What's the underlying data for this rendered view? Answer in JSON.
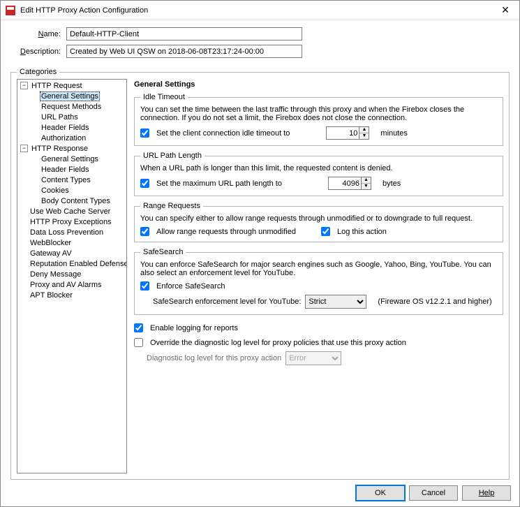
{
  "window": {
    "title": "Edit HTTP Proxy Action Configuration"
  },
  "header": {
    "name_label": "Name:",
    "name_value": "Default-HTTP-Client",
    "desc_label": "Description:",
    "desc_value": "Created by Web UI QSW on 2018-06-08T23:17:24-00:00"
  },
  "categories": {
    "legend": "Categories",
    "tree": {
      "http_request": "HTTP Request",
      "req_general": "General Settings",
      "req_methods": "Request Methods",
      "url_paths": "URL Paths",
      "header_fields": "Header Fields",
      "authorization": "Authorization",
      "http_response": "HTTP Response",
      "resp_general": "General Settings",
      "resp_header": "Header Fields",
      "content_types": "Content Types",
      "cookies": "Cookies",
      "body_content": "Body Content Types",
      "web_cache": "Use Web Cache Server",
      "proxy_exc": "HTTP Proxy Exceptions",
      "dlp": "Data Loss Prevention",
      "webblocker": "WebBlocker",
      "gav": "Gateway AV",
      "red": "Reputation Enabled Defense",
      "deny": "Deny Message",
      "alarms": "Proxy and AV Alarms",
      "apt": "APT Blocker"
    }
  },
  "pane": {
    "title": "General Settings",
    "idle": {
      "legend": "Idle Timeout",
      "desc": "You can set the time between the last traffic through this proxy and when the Firebox closes the connection. If you do not set a limit, the Firebox does not close the connection.",
      "cb_label": "Set the client connection idle timeout to",
      "value": "10",
      "unit": "minutes"
    },
    "url": {
      "legend": "URL Path Length",
      "desc": "When a URL path is longer than this limit, the requested content is denied.",
      "cb_label": "Set the maximum URL path length to",
      "value": "4096",
      "unit": "bytes"
    },
    "range": {
      "legend": "Range Requests",
      "desc": "You can specify either to allow range requests through unmodified or to downgrade to full request.",
      "cb1": "Allow range requests through unmodified",
      "cb2": "Log this action"
    },
    "safe": {
      "legend": "SafeSearch",
      "desc": "You can enforce SafeSearch for major search engines such as Google, Yahoo, Bing, YouTube. You can also select an enforcement level for YouTube.",
      "cb": "Enforce SafeSearch",
      "level_label": "SafeSearch enforcement level for YouTube:",
      "level_value": "Strict",
      "note": "(Fireware OS v12.2.1 and higher)"
    },
    "logging_cb": "Enable logging for reports",
    "override_cb": "Override the diagnostic log level for proxy policies that use this proxy action",
    "diag_label": "Diagnostic log level for this proxy action",
    "diag_value": "Error"
  },
  "buttons": {
    "ok": "OK",
    "cancel": "Cancel",
    "help": "Help"
  }
}
